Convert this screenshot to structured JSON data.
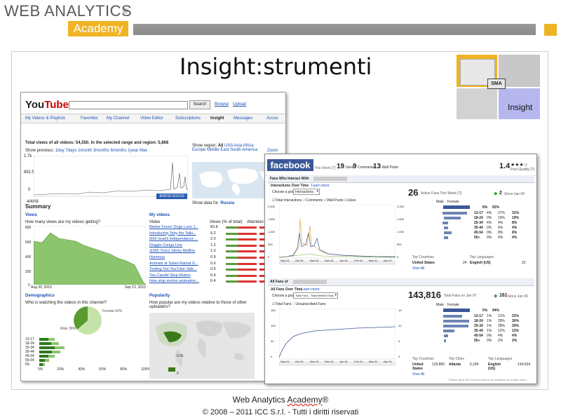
{
  "header": {
    "brand_name": "WEB ANALYTICS",
    "brand_reg": "®",
    "brand_sub": "Academy",
    "colors": {
      "accent": "#f0b323",
      "bar": "#8e8e8e"
    }
  },
  "slide": {
    "title": "Insight:strumenti",
    "badge": {
      "center": "SMA",
      "label": "Insight"
    }
  },
  "youtube": {
    "logo": "YouTube",
    "search_button": "Search",
    "links": [
      "Browse",
      "Upload"
    ],
    "tabs": [
      "My Videos & Playlists",
      "Favorites",
      "My Channel",
      "Video Editor",
      "Subscriptions",
      "Insight",
      "Messages",
      "Accou"
    ],
    "total_views": "Total views of all videos: 54,550.  In the selected range and region: 5,866",
    "show_previous_label": "Show previous:",
    "ranges": [
      "1day",
      "7days",
      "1month",
      "3months",
      "6months",
      "1year",
      "Max"
    ],
    "y_ticks": [
      "1.7k",
      "852.5",
      "0"
    ],
    "x_start": "4/4/08",
    "range_box": "8/30/10-9/12/10",
    "show_region_label": "Show region:",
    "region_all": "All",
    "regions": [
      "USA",
      "Asia",
      "Africa",
      "Europe",
      "Middle East",
      "South America"
    ],
    "zoom": "Zoom",
    "show_data_for_label": "Show data for:",
    "show_data_for_value": "Russia",
    "summary": "Summary",
    "views_heading": "Views",
    "views_q": "How many views are my videos getting?",
    "views_y": [
      "800",
      "600",
      "400",
      "200",
      "0"
    ],
    "views_dates": [
      "Aug 30, 2010",
      "Sep 12, 2010"
    ],
    "my_videos_heading": "My videos",
    "table_headers": [
      "Video",
      "Views (% of total)",
      "Attention"
    ],
    "videos": [
      {
        "title": "Bieber Fever! Dogs Love J...",
        "pct": "83.8"
      },
      {
        "title": "Introducing Toby the Talki...",
        "pct": "9.2"
      },
      {
        "title": "60th Israeli Independance ...",
        "pct": "2.0"
      },
      {
        "title": "Doggie Conga Line",
        "pct": "1.2"
      },
      {
        "title": "3/355 Tina's Stinky Muffins",
        "pct": "1.0"
      },
      {
        "title": "Hummus",
        "pct": "0.9"
      },
      {
        "title": "Animals at Safari Ramat G...",
        "pct": "0.6"
      },
      {
        "title": "Testing Out YouTube Vide...",
        "pct": "0.5"
      },
      {
        "title": "Tea Candle Stop Motion",
        "pct": "0.4"
      },
      {
        "title": "How stop motion animation...",
        "pct": "0.4"
      }
    ],
    "demographics_heading": "Demographics",
    "demographics_q": "Who is watching the videos in this channel?",
    "female_label": "Female 62%",
    "male_label": "Male 38%",
    "age_labels": [
      "13-17",
      "18-24",
      "25-34",
      "35-44",
      "45-54",
      "55-64",
      "65-"
    ],
    "age_axis": [
      "0%",
      "20%",
      "40%",
      "60%",
      "80%",
      "100%"
    ],
    "popularity_heading": "Popularity",
    "popularity_q": "How popular are my videos relative to those of other uploaders?",
    "pop_legend": [
      "0.41",
      "0"
    ]
  },
  "facebook": {
    "logo": "facebook",
    "top_stats": [
      {
        "label": "This Week [?]",
        "value": ""
      },
      {
        "value": "19",
        "label": "Likes"
      },
      {
        "value": "9",
        "label": "Comments"
      },
      {
        "value": "13",
        "label": "Wall Posts"
      }
    ],
    "quality": "1.4",
    "quality_label": "Post Quality [?]",
    "section1_title": "Fans Who Interact With",
    "interactions_label": "Interactions Over Time",
    "learn_more": "Learn more",
    "choose_graph": "Choose a graph:",
    "graph_select_1": "Interactions",
    "legend1": [
      "Total Interactions",
      "Comments",
      "Wall Posts",
      "Likes"
    ],
    "y_left_1": [
      "2,000",
      "1,500",
      "1,000",
      "500",
      "0"
    ],
    "y_right_1": [
      "2,000",
      "1,500",
      "1,000",
      "500",
      "0"
    ],
    "x_dates": [
      "Sep 01",
      "Oct 01",
      "Nov 01",
      "Dec 01",
      "Jan 01",
      "Feb 01",
      "Mar 01",
      "Apr 01"
    ],
    "active_fans": "26",
    "active_fans_label": "Active Fans This Week [?]",
    "active_change": "2",
    "active_change_label": "Since Jan 04",
    "gender_headers": [
      "Male",
      "Female"
    ],
    "gender_total_1": [
      "8%",
      "92%"
    ],
    "ages": [
      "13-17",
      "18-24",
      "25-34",
      "35-44",
      "45-54",
      "55+"
    ],
    "age_rows_1": [
      [
        "4%",
        "27%",
        "31%"
      ],
      [
        "0%",
        "19%",
        "19%"
      ],
      [
        "4%",
        "4%",
        "8%"
      ],
      [
        "0%",
        "4%",
        "4%"
      ],
      [
        "0%",
        "8%",
        "8%"
      ],
      [
        "0%",
        "4%",
        "4%"
      ]
    ],
    "top_countries_label": "Top Countries",
    "top_languages_label": "Top Languages",
    "country_1": "United States",
    "country_1_val": "24",
    "language_1": "English (US)",
    "language_1_val": "22",
    "view_all": "View All",
    "section2_title": "All Fans of",
    "fans_over_time": "All Fans Over Time",
    "graph_select_2": "Total Fans - Total/Verified Fans",
    "legend2": [
      "Total Fans",
      "Unsubscribed Fans"
    ],
    "y_left_2": [
      "150",
      "100",
      "50",
      "0"
    ],
    "y_right_2": [
      "15",
      "10",
      "5",
      "0"
    ],
    "total_fans": "143,816",
    "total_fans_label": "Total Fans on Jan 07",
    "total_change": "161",
    "total_change_label": "Since Jan 06",
    "gender_total_2": [
      "5%",
      "94%"
    ],
    "age_rows_2": [
      [
        "1%",
        "21%",
        "22%"
      ],
      [
        "1%",
        "29%",
        "30%"
      ],
      [
        "1%",
        "28%",
        "29%"
      ],
      [
        "1%",
        "12%",
        "13%"
      ],
      [
        "0%",
        "4%",
        "4%"
      ],
      [
        "0%",
        "2%",
        "2%"
      ]
    ],
    "country_2": "United States",
    "country_2_val": "129,883",
    "city_label": "Top Cities",
    "city_2": "Atlanta",
    "city_2_val": "6,184",
    "language_2": "English (US)",
    "language_2_val": "134,634",
    "footnote": "Please allow 48 hours for data to be available for a daily report."
  },
  "footer": {
    "line1_text": "Web Analytics ",
    "line1_underlined": "Academy",
    "line1_reg": "®",
    "line2": "© 2008 – 2011 ICC S.r.l. - Tutti i diritti riservati"
  }
}
